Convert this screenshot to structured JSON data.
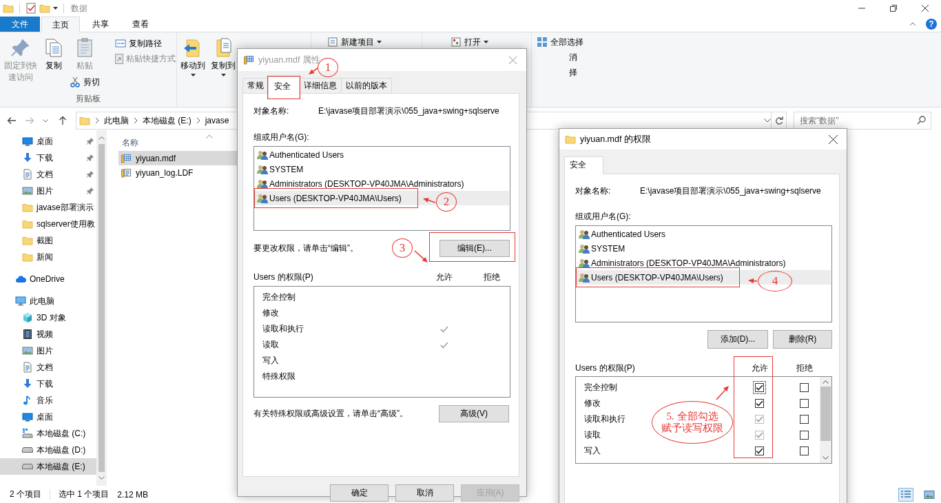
{
  "window": {
    "title": "数据",
    "help": "?"
  },
  "ribbon": {
    "tabs": [
      {
        "label": "文件",
        "kind": "file",
        "selected": false
      },
      {
        "label": "主页",
        "kind": "tab",
        "selected": true
      },
      {
        "label": "共享",
        "kind": "tab",
        "selected": false
      },
      {
        "label": "查看",
        "kind": "tab",
        "selected": false
      }
    ],
    "clipboard": {
      "label": "剪贴板",
      "pin": {
        "label": "固定到快速访问",
        "disabled": true
      },
      "copy": {
        "label": "复制",
        "disabled": false
      },
      "paste": {
        "label": "粘贴",
        "disabled": true
      },
      "cut": {
        "label": "剪切",
        "disabled": false
      },
      "copy_path": {
        "label": "复制路径",
        "disabled": false
      },
      "paste_shortcut": {
        "label": "粘贴快捷方式",
        "disabled": true
      }
    },
    "organize": {
      "move_to": "移动到",
      "copy_to": "复制到"
    },
    "new": {
      "new_item": "新建项目"
    },
    "open": {
      "open": "打开"
    },
    "select": {
      "select_all": "全部选择",
      "item_2": "消",
      "item_3": "择"
    }
  },
  "address": {
    "crumbs": [
      "此电脑",
      "本地磁盘 (E:)",
      "javase"
    ],
    "search_placeholder": "搜索\"数据\""
  },
  "nav": {
    "quick_access": [
      {
        "label": "桌面",
        "kind": "desktop",
        "pinned": true,
        "selected": false
      },
      {
        "label": "下载",
        "kind": "download",
        "pinned": true,
        "selected": false
      },
      {
        "label": "文档",
        "kind": "document",
        "pinned": true,
        "selected": false
      },
      {
        "label": "图片",
        "kind": "picture",
        "pinned": true,
        "selected": false
      },
      {
        "label": "javase部署演示",
        "kind": "folder",
        "pinned": false,
        "selected": false
      },
      {
        "label": "sqlserver使用教",
        "kind": "folder",
        "pinned": false,
        "selected": false
      },
      {
        "label": "截图",
        "kind": "folder",
        "pinned": false,
        "selected": false
      },
      {
        "label": "新闻",
        "kind": "folder",
        "pinned": false,
        "selected": false
      }
    ],
    "locations": [
      {
        "label": "OneDrive",
        "kind": "cloud",
        "selected": false
      },
      {
        "label": "此电脑",
        "kind": "pc",
        "selected": false,
        "children": [
          {
            "label": "3D 对象",
            "kind": "cube",
            "selected": false
          },
          {
            "label": "视频",
            "kind": "film",
            "selected": false
          },
          {
            "label": "图片",
            "kind": "picture",
            "selected": false
          },
          {
            "label": "文档",
            "kind": "document",
            "selected": false
          },
          {
            "label": "下载",
            "kind": "download",
            "selected": false
          },
          {
            "label": "音乐",
            "kind": "music",
            "selected": false
          },
          {
            "label": "桌面",
            "kind": "desktop",
            "selected": false
          },
          {
            "label": "本地磁盘 (C:)",
            "kind": "system_drive",
            "selected": false
          },
          {
            "label": "本地磁盘 (D:)",
            "kind": "drive",
            "selected": false
          },
          {
            "label": "本地磁盘 (E:)",
            "kind": "drive",
            "selected": true
          }
        ]
      }
    ]
  },
  "content": {
    "column": "名称",
    "files": [
      {
        "name": "yiyuan.mdf",
        "kind": "database",
        "selected": true
      },
      {
        "name": "yiyuan_log.LDF",
        "kind": "log",
        "selected": false
      }
    ]
  },
  "status_bar": {
    "items": "2 个项目",
    "selection": "选中 1 个项目",
    "size": "2.12 MB",
    "views": [
      {
        "kind": "details",
        "selected": true
      },
      {
        "kind": "thumbnails",
        "selected": false
      }
    ]
  },
  "properties_dialog": {
    "title": "yiyuan.mdf 属性",
    "tabs": [
      {
        "label": "常规",
        "selected": false,
        "highlighted": false
      },
      {
        "label": "安全",
        "selected": true,
        "highlighted": true
      },
      {
        "label": "详细信息",
        "selected": false,
        "highlighted": false
      },
      {
        "label": "以前的版本",
        "selected": false,
        "highlighted": false
      }
    ],
    "object_label": "对象名称:",
    "object_value": "E:\\javase项目部署演示\\055_java+swing+sqlserve",
    "groups_label": "组或用户名(G):",
    "groups": [
      {
        "name": "Authenticated Users",
        "selected": false,
        "highlighted": false
      },
      {
        "name": "SYSTEM",
        "selected": false,
        "highlighted": false
      },
      {
        "name": "Administrators (DESKTOP-VP40JMA\\Administrators)",
        "selected": false,
        "highlighted": false
      },
      {
        "name": "Users (DESKTOP-VP40JMA\\Users)",
        "selected": true,
        "highlighted": true
      }
    ],
    "edit_hint": "要更改权限，请单击“编辑”。",
    "edit_button": {
      "label": "编辑(E)...",
      "highlighted": true
    },
    "perm_label": "Users 的权限(P)",
    "allow_label": "允许",
    "deny_label": "拒绝",
    "permissions": [
      {
        "label": "完全控制",
        "allow": false,
        "deny": false
      },
      {
        "label": "修改",
        "allow": false,
        "deny": false
      },
      {
        "label": "读取和执行",
        "allow": true,
        "deny": false
      },
      {
        "label": "读取",
        "allow": true,
        "deny": false
      },
      {
        "label": "写入",
        "allow": false,
        "deny": false
      },
      {
        "label": "特殊权限",
        "allow": false,
        "deny": false
      }
    ],
    "advanced_hint": "有关特殊权限或高级设置，请单击“高级”。",
    "advanced_button": "高级(V)",
    "buttons": [
      {
        "label": "确定",
        "disabled": false
      },
      {
        "label": "取消",
        "disabled": false
      },
      {
        "label": "应用(A)",
        "disabled": true
      }
    ]
  },
  "permissions_dialog": {
    "title": "yiyuan.mdf 的权限",
    "tabs": [
      {
        "label": "安全",
        "selected": true
      }
    ],
    "object_label": "对象名称:",
    "object_value": "E:\\javase项目部署演示\\055_java+swing+sqlserve",
    "groups_label": "组或用户名(G):",
    "groups": [
      {
        "name": "Authenticated Users",
        "selected": false,
        "highlighted": false
      },
      {
        "name": "SYSTEM",
        "selected": false,
        "highlighted": false
      },
      {
        "name": "Administrators (DESKTOP-VP40JMA\\Administrators)",
        "selected": false,
        "highlighted": false
      },
      {
        "name": "Users (DESKTOP-VP40JMA\\Users)",
        "selected": true,
        "highlighted": true
      }
    ],
    "add_button": "添加(D)...",
    "remove_button": "删除(R)",
    "perm_label": "Users 的权限(P)",
    "allow_label": "允许",
    "deny_label": "拒绝",
    "allow_highlighted": true,
    "permissions": [
      {
        "label": "完全控制",
        "allow": true,
        "allow_disabled": false,
        "focused": true,
        "deny": false
      },
      {
        "label": "修改",
        "allow": true,
        "allow_disabled": false,
        "focused": false,
        "deny": false
      },
      {
        "label": "读取和执行",
        "allow": true,
        "allow_disabled": true,
        "focused": false,
        "deny": false
      },
      {
        "label": "读取",
        "allow": true,
        "allow_disabled": true,
        "focused": false,
        "deny": false
      },
      {
        "label": "写入",
        "allow": true,
        "allow_disabled": false,
        "focused": false,
        "deny": false
      }
    ]
  },
  "annotations": [
    {
      "lines": [
        "1"
      ]
    },
    {
      "lines": [
        "2"
      ]
    },
    {
      "lines": [
        "3"
      ]
    },
    {
      "lines": [
        "4"
      ]
    },
    {
      "lines": [
        "5. 全部勾选",
        "赋予读写权限"
      ]
    }
  ]
}
